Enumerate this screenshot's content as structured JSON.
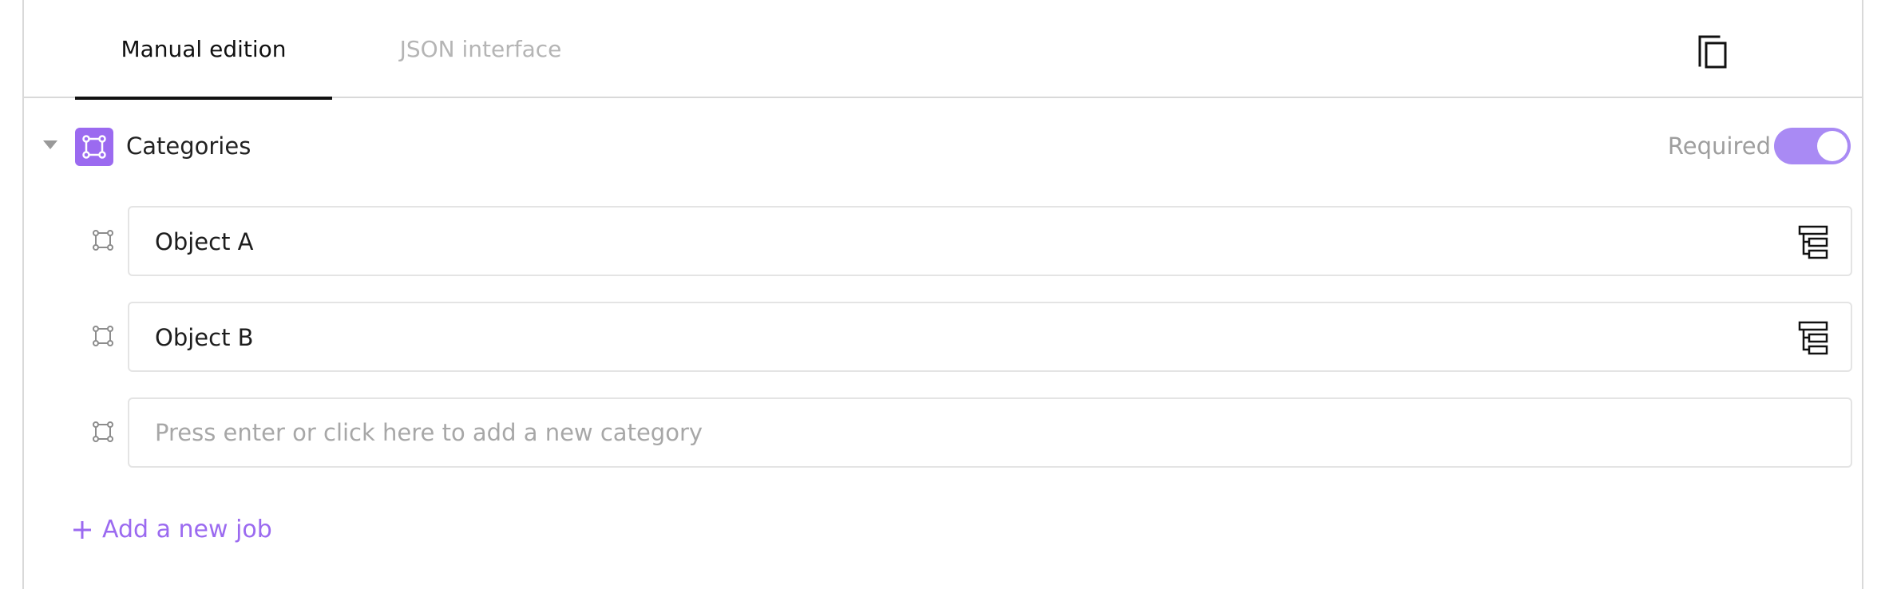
{
  "tabs": {
    "manual": "Manual edition",
    "json": "JSON interface",
    "active": "Manual edition"
  },
  "toolbar": {
    "copy_icon": "copy-icon"
  },
  "category": {
    "label": "Categories",
    "icon": "bounding-box-icon",
    "required_label": "Required",
    "required": true
  },
  "objects": [
    {
      "label": "Object A",
      "icon": "bounding-box-icon",
      "action_icon": "tree-structure-icon"
    },
    {
      "label": "Object B",
      "icon": "bounding-box-icon",
      "action_icon": "tree-structure-icon"
    }
  ],
  "new_category": {
    "placeholder": "Press enter or click here to add a new category",
    "value": ""
  },
  "add_job": {
    "label": "Add a new job",
    "icon": "plus-icon"
  },
  "colors": {
    "accent": "#9b6af0",
    "toggle_on": "#a98af4",
    "text": "#1d1d1d",
    "muted": "#a7a7a7",
    "border": "#e4e4e4"
  }
}
